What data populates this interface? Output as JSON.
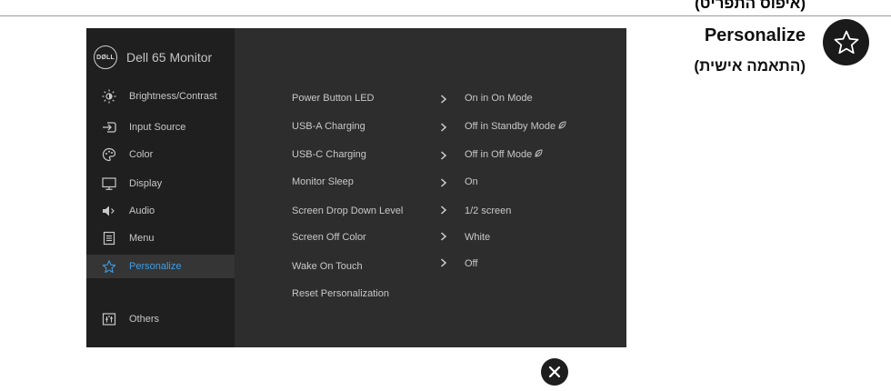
{
  "page": {
    "top_heading": "(איפוס התפריט)",
    "side_title": "Personalize",
    "side_subtitle": "(התאמה אישית)"
  },
  "osd": {
    "brand": "Dell 65 Monitor",
    "logo_text": "DØLL",
    "menu": [
      {
        "label": "Brightness/Contrast",
        "icon": "brightness-icon"
      },
      {
        "label": "Input Source",
        "icon": "input-source-icon"
      },
      {
        "label": "Color",
        "icon": "color-palette-icon"
      },
      {
        "label": "Display",
        "icon": "display-icon"
      },
      {
        "label": "Audio",
        "icon": "speaker-icon"
      },
      {
        "label": "Menu",
        "icon": "menu-icon"
      },
      {
        "label": "Personalize",
        "icon": "star-icon",
        "active": true
      },
      {
        "label": "Others",
        "icon": "others-icon"
      }
    ],
    "submenu": [
      {
        "label": "Power Button LED",
        "value": "On in On Mode"
      },
      {
        "label": "USB-A Charging",
        "value": "Off in Standby Mode"
      },
      {
        "label": "USB-C Charging",
        "value": "Off in Off Mode"
      },
      {
        "label": "Monitor Sleep",
        "value": "On"
      },
      {
        "label": "Screen Drop Down Level",
        "value": "1/2 screen"
      },
      {
        "label": "Screen Off Color",
        "value": "White"
      },
      {
        "label": "Wake On Touch",
        "value": "Off"
      },
      {
        "label": "Reset Personalization",
        "value": ""
      }
    ]
  },
  "colors": {
    "accent": "#3d9ee8",
    "osd_background": "#2d2d2d",
    "osd_sidebar": "#1f1f1f"
  }
}
